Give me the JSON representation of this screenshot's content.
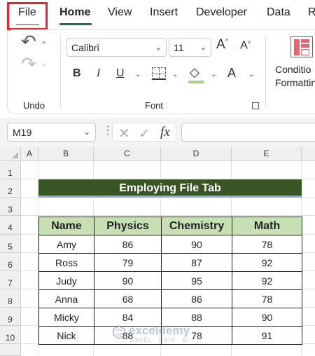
{
  "ribbon_tabs": {
    "file": "File",
    "home": "Home",
    "view": "View",
    "insert": "Insert",
    "developer": "Developer",
    "data": "Data",
    "review": "R"
  },
  "ribbon": {
    "undo_group_label": "Undo",
    "font_group_label": "Font",
    "font_name": "Calibri",
    "font_size": "11",
    "conditional_formatting_line1": "Conditio",
    "conditional_formatting_line2": "Formattin",
    "icons": [
      "undo-icon",
      "redo-icon",
      "increase-font-size-icon",
      "decrease-font-size-icon",
      "bold-icon",
      "italic-icon",
      "underline-icon",
      "borders-icon",
      "fill-color-icon",
      "font-color-icon",
      "dialog-launcher-icon",
      "conditional-formatting-icon"
    ],
    "fill_color": "#a8d08d"
  },
  "formula_bar": {
    "name_box": "M19",
    "formula": ""
  },
  "grid": {
    "columns": [
      "A",
      "B",
      "C",
      "D",
      "E"
    ],
    "rows": [
      "1",
      "2",
      "3",
      "4",
      "5",
      "6",
      "7",
      "8",
      "9",
      "10"
    ]
  },
  "sheet": {
    "title": "Employing File Tab",
    "title_bg": "#375623",
    "header_bg": "#c6e0b4",
    "headers": [
      "Name",
      "Physics",
      "Chemistry",
      "Math"
    ],
    "rows": [
      [
        "Amy",
        "86",
        "90",
        "78"
      ],
      [
        "Ross",
        "79",
        "87",
        "92"
      ],
      [
        "Judy",
        "90",
        "95",
        "92"
      ],
      [
        "Anna",
        "68",
        "86",
        "78"
      ],
      [
        "Micky",
        "84",
        "88",
        "90"
      ],
      [
        "Nick",
        "88",
        "78",
        "91"
      ]
    ]
  },
  "watermark": {
    "name": "exceldemy",
    "tagline": "EXCEL · DATA · BI"
  }
}
